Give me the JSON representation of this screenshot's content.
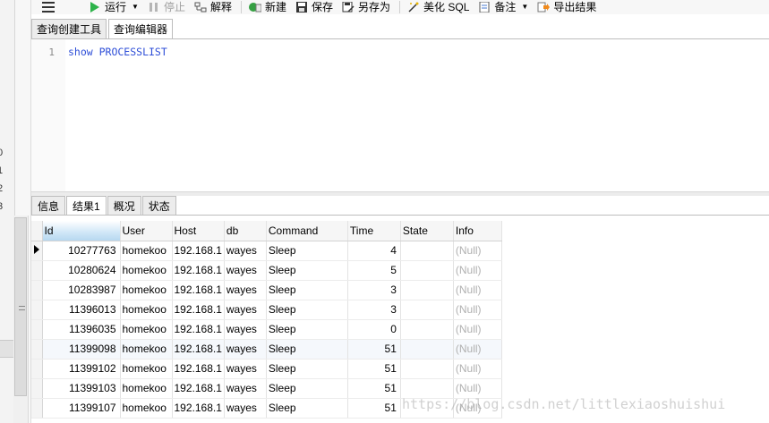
{
  "toolbar": {
    "run": "运行",
    "stop": "停止",
    "explain": "解释",
    "new": "新建",
    "save": "保存",
    "save_as": "另存为",
    "beautify": "美化 SQL",
    "backup": "备注",
    "export": "导出结果"
  },
  "editor_tabs": [
    "查询创建工具",
    "查询编辑器"
  ],
  "editor": {
    "line_number": "1",
    "code": "show PROCESSLIST"
  },
  "left_strip_numbers": [
    "0",
    "1",
    "2",
    "3"
  ],
  "result_tabs": [
    "信息",
    "结果1",
    "概况",
    "状态"
  ],
  "grid": {
    "columns": [
      "Id",
      "User",
      "Host",
      "db",
      "Command",
      "Time",
      "State",
      "Info"
    ],
    "rows": [
      [
        "10277763",
        "homekoo",
        "192.168.1",
        "wayes",
        "Sleep",
        "4",
        "",
        "(Null)"
      ],
      [
        "10280624",
        "homekoo",
        "192.168.1",
        "wayes",
        "Sleep",
        "5",
        "",
        "(Null)"
      ],
      [
        "10283987",
        "homekoo",
        "192.168.1",
        "wayes",
        "Sleep",
        "3",
        "",
        "(Null)"
      ],
      [
        "11396013",
        "homekoo",
        "192.168.1",
        "wayes",
        "Sleep",
        "3",
        "",
        "(Null)"
      ],
      [
        "11396035",
        "homekoo",
        "192.168.1",
        "wayes",
        "Sleep",
        "0",
        "",
        "(Null)"
      ],
      [
        "11399098",
        "homekoo",
        "192.168.1",
        "wayes",
        "Sleep",
        "51",
        "",
        "(Null)"
      ],
      [
        "11399102",
        "homekoo",
        "192.168.1",
        "wayes",
        "Sleep",
        "51",
        "",
        "(Null)"
      ],
      [
        "11399103",
        "homekoo",
        "192.168.1",
        "wayes",
        "Sleep",
        "51",
        "",
        "(Null)"
      ],
      [
        "11399107",
        "homekoo",
        "192.168.1",
        "wayes",
        "Sleep",
        "51",
        "",
        "(Null)"
      ]
    ]
  },
  "watermark": "https://blog.csdn.net/littlexiaoshuishui",
  "colors": {
    "keyword": "#2f4fd8",
    "null_text": "#b0b0b0",
    "selected_header": "#cfe6f7"
  }
}
